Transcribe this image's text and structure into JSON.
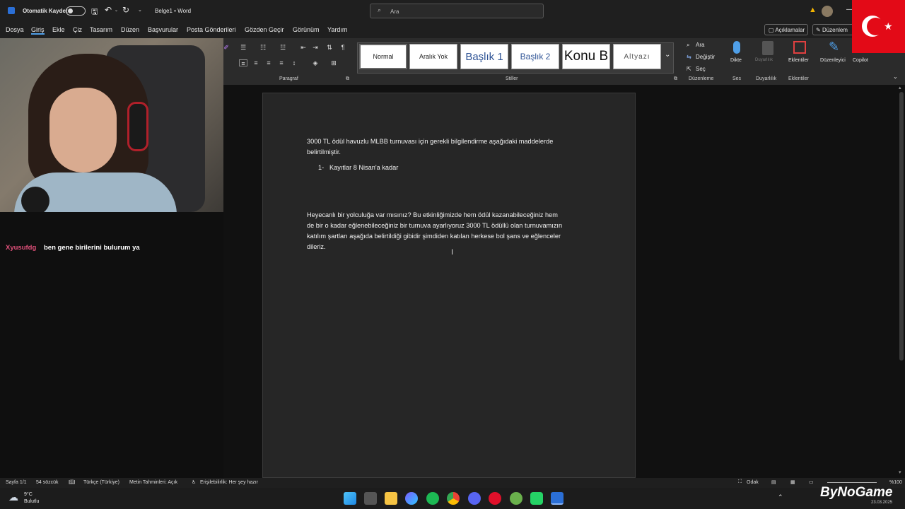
{
  "titlebar": {
    "autosave_label": "Otomatik Kaydet",
    "doc_title": "Belge1 • Word",
    "search_placeholder": "Ara"
  },
  "menu": [
    "Dosya",
    "Giriş",
    "Ekle",
    "Çiz",
    "Tasarım",
    "Düzen",
    "Başvurular",
    "Posta Gönderileri",
    "Gözden Geçir",
    "Görünüm",
    "Yardım"
  ],
  "right_buttons": {
    "comments": "Açıklamalar",
    "editing": "Düzenlem"
  },
  "ribbon": {
    "groups": {
      "paragraph": "Paragraf",
      "styles": "Stiller",
      "editing": "Düzenleme",
      "voice": "Ses",
      "sensitivity": "Duyarlılık",
      "addins": "Eklentiler"
    },
    "styles": [
      "Normal",
      "Aralık Yok",
      "Başlık 1",
      "Başlık 2",
      "Konu B",
      "Altyazı"
    ],
    "edit_items": [
      "Ara",
      "Değiştir",
      "Seç"
    ],
    "big_buttons": {
      "dictate": "Dikte",
      "sensitivity": "Duyarlılık",
      "addins": "Eklentiler",
      "editor": "Düzenleyici",
      "copilot": "Copilot"
    }
  },
  "document": {
    "para1_line1": "3000 TL ödül havuzlu MLBB turnuvası için gerekli bilgilendirme aşağıdaki maddelerde",
    "para1_line2": "belirtilmiştir.",
    "list_num": "1-",
    "list_item1": "Kayıtlar 8 Nisan'a kadar",
    "para2_line1": "Heyecanlı bir yolculuğa var mısınız? Bu etkinliğimizde hem ödül kazanabileceğiniz hem",
    "para2_line2": "de bir o kadar eğlenebileceğiniz bir turnuva ayarlıyoruz 3000 TL ödüllü olan turnuvamızın",
    "para2_line3": "katılım şartları aşağıda belirtildiği gibidir şimdiden katılan herkese bol şans ve eğlenceler",
    "para2_line4": "dileriz."
  },
  "chat": {
    "user": "Xyusufdg",
    "message": "ben gene birilerini bulurum ya",
    "user_color": "#e0507a"
  },
  "statusbar": {
    "page": "Sayfa 1/1",
    "words": "54 sözcük",
    "language": "Türkçe (Türkiye)",
    "predictions": "Metin Tahminleri: Açık",
    "accessibility": "Erişilebilirlik: Her şey hazır",
    "focus": "Odak",
    "zoom": "%100"
  },
  "taskbar": {
    "weather_temp": "9°C",
    "weather_desc": "Bulutlu",
    "date": "23.03.2025",
    "watermark": "ByNoGame"
  },
  "colors": {
    "accent": "#4f9fe8",
    "flag_red": "#e30a17"
  }
}
